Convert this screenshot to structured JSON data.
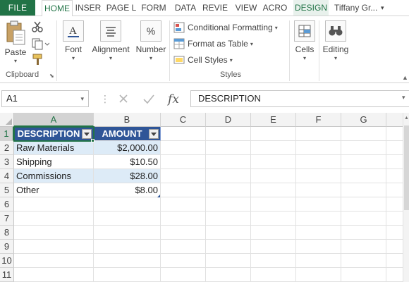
{
  "tabs": {
    "file": "FILE",
    "items": [
      {
        "label": "HOME",
        "active": true
      },
      {
        "label": "INSER"
      },
      {
        "label": "PAGE L"
      },
      {
        "label": "FORM"
      },
      {
        "label": "DATA"
      },
      {
        "label": "REVIE"
      },
      {
        "label": "VIEW"
      },
      {
        "label": "ACRO"
      },
      {
        "label": "DESIGN",
        "contextual": true
      }
    ],
    "user": "Tiffany Gr..."
  },
  "ribbon": {
    "clipboard": {
      "paste": "Paste",
      "group_label": "Clipboard",
      "icons": [
        "paste-icon",
        "cut-icon",
        "copy-icon",
        "format-painter-icon"
      ]
    },
    "font": {
      "label": "Font",
      "icon": "font-icon"
    },
    "alignment": {
      "label": "Alignment",
      "icon": "alignment-icon"
    },
    "number": {
      "label": "Number",
      "icon": "percent-icon",
      "symbol": "%"
    },
    "styles": {
      "conditional_formatting": "Conditional Formatting",
      "format_as_table": "Format as Table",
      "cell_styles": "Cell Styles",
      "group_label": "Styles"
    },
    "cells": {
      "label": "Cells",
      "icon": "cells-icon"
    },
    "editing": {
      "label": "Editing",
      "icon": "binoculars-icon"
    }
  },
  "formula_bar": {
    "name_box": "A1",
    "fx": "fx",
    "content": "DESCRIPTION"
  },
  "sheet": {
    "columns": [
      "A",
      "B",
      "C",
      "D",
      "E",
      "F",
      "G"
    ],
    "rows": [
      "1",
      "2",
      "3",
      "4",
      "5",
      "6",
      "7",
      "8",
      "9",
      "10",
      "11"
    ],
    "table_headers": [
      "DESCRIPTION",
      "AMOUNT"
    ],
    "table_rows": [
      {
        "description": "Raw Materials",
        "amount": "$2,000.00"
      },
      {
        "description": "Shipping",
        "amount": "$10.50"
      },
      {
        "description": "Commissions",
        "amount": "$28.00"
      },
      {
        "description": "Other",
        "amount": "$8.00"
      }
    ],
    "selected_cell": "A1"
  },
  "colors": {
    "accent": "#217346",
    "table_header": "#2f5597",
    "table_band": "#ddebf7"
  }
}
